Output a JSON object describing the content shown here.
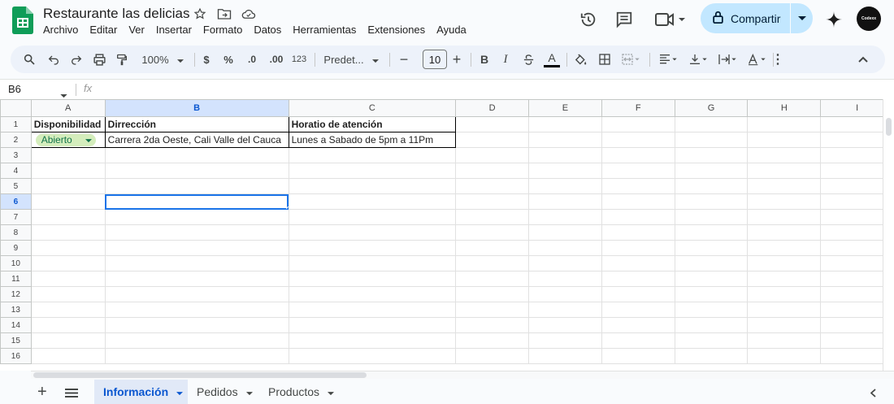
{
  "app": {
    "title": "Restaurante las delicias",
    "menu": [
      "Archivo",
      "Editar",
      "Ver",
      "Insertar",
      "Formato",
      "Datos",
      "Herramientas",
      "Extensiones",
      "Ayuda"
    ],
    "share_label": "Compartir",
    "avatar_text": "Codexx"
  },
  "toolbar": {
    "zoom": "100%",
    "currency": "$",
    "percent": "%",
    "decimal_decrease": ".0",
    "decimal_increase": ".00",
    "number_format": "123",
    "font": "Predet...",
    "font_size": "10",
    "bold": "B",
    "italic": "I",
    "text_color": "A"
  },
  "formula_bar": {
    "name_box": "B6",
    "fx": "fx",
    "content": ""
  },
  "grid": {
    "columns": [
      "A",
      "B",
      "C",
      "D",
      "E",
      "F",
      "G",
      "H",
      "I"
    ],
    "row_numbers": [
      "1",
      "2",
      "3",
      "4",
      "5",
      "6",
      "7",
      "8",
      "9",
      "10",
      "11",
      "12",
      "13",
      "14",
      "15",
      "16"
    ],
    "headers": [
      "Disponibilidad",
      "Dirrección",
      "Horatio de atención"
    ],
    "row2": {
      "status_chip": "Abierto",
      "address": "Carrera 2da Oeste, Cali Valle del Cauca",
      "hours": "Lunes a Sabado de 5pm a 11Pm"
    },
    "selected_cell": "B6"
  },
  "sheets": [
    {
      "name": "Información",
      "active": true
    },
    {
      "name": "Pedidos",
      "active": false
    },
    {
      "name": "Productos",
      "active": false
    }
  ],
  "colors": {
    "accent": "#0b57d0",
    "share_bg": "#c2e7ff",
    "chip_bg": "#d4edbc",
    "chip_text": "#11734b",
    "sheets_green": "#0f9d58"
  }
}
